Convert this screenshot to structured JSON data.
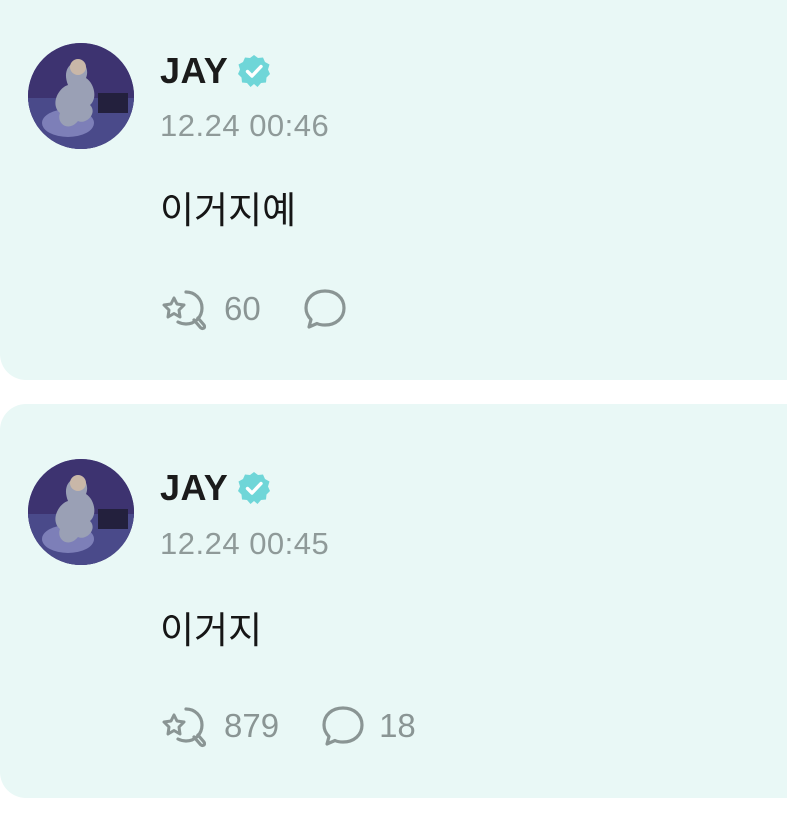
{
  "posts": [
    {
      "author": "JAY",
      "verified_icon": "verified-badge-icon",
      "timestamp": "12.24 00:46",
      "content": "이거지예",
      "likes": "60",
      "comments": ""
    },
    {
      "author": "JAY",
      "verified_icon": "verified-badge-icon",
      "timestamp": "12.24 00:45",
      "content": "이거지",
      "likes": "879",
      "comments": "18"
    }
  ],
  "colors": {
    "card_background": "#e9f8f6",
    "verified_badge": "#5fd3d6",
    "timestamp_text": "#8f9a99",
    "icon_stroke": "#8a9594"
  }
}
